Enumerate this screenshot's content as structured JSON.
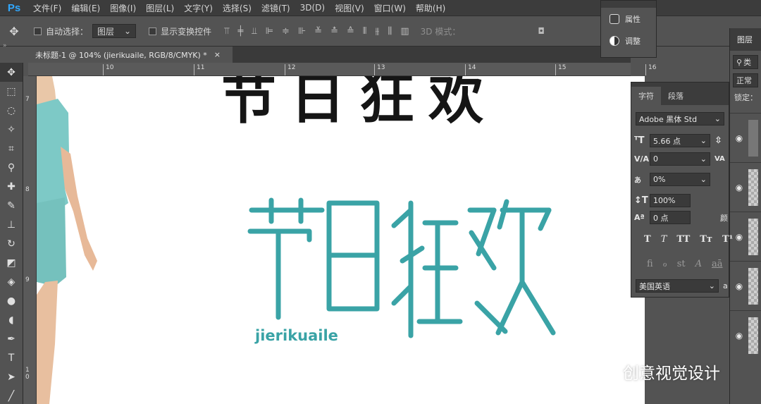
{
  "app": {
    "logo": "Ps"
  },
  "menu": [
    "文件(F)",
    "编辑(E)",
    "图像(I)",
    "图层(L)",
    "文字(Y)",
    "选择(S)",
    "滤镜(T)",
    "3D(D)",
    "视图(V)",
    "窗口(W)",
    "帮助(H)"
  ],
  "options": {
    "auto_select_label": "自动选择：",
    "auto_select_value": "图层",
    "show_transform_label": "显示变换控件",
    "mode_3d_label": "3D 模式："
  },
  "popup": {
    "properties_label": "属性",
    "adjustments_label": "调整"
  },
  "document": {
    "tab_title": "未标题-1 @ 104% (jierikuaile, RGB/8/CMYK) *",
    "close_glyph": "×"
  },
  "rulers": {
    "top": [
      "10",
      "11",
      "12",
      "13",
      "14",
      "15",
      "16"
    ],
    "left": [
      "7",
      "8",
      "9",
      "1 0"
    ]
  },
  "canvas": {
    "title_text": "节日狂欢",
    "subtitle_text": "jierikuaile",
    "colors": {
      "teal": "#3aa3a6",
      "black": "#151515"
    }
  },
  "character_panel": {
    "tab_character": "字符",
    "tab_paragraph": "段落",
    "font_family": "Adobe 黑体 Std",
    "font_size": "5.66 点",
    "kerning": "0",
    "tracking": "0%",
    "vertical_scale": "100%",
    "baseline_shift": "0 点",
    "color_label": "颜",
    "style_buttons": [
      "T",
      "T",
      "TT",
      "Tт",
      "T¹"
    ],
    "opentype_buttons": [
      "fi",
      "ℴ",
      "st",
      "A",
      "aā"
    ],
    "language": "美国英语",
    "aa_label": "a"
  },
  "layers_panel": {
    "tab_label": "图层",
    "search_kind": "类",
    "blend_mode": "正常",
    "lock_label": "锁定："
  },
  "watermark": {
    "text": "创意视觉设计"
  }
}
